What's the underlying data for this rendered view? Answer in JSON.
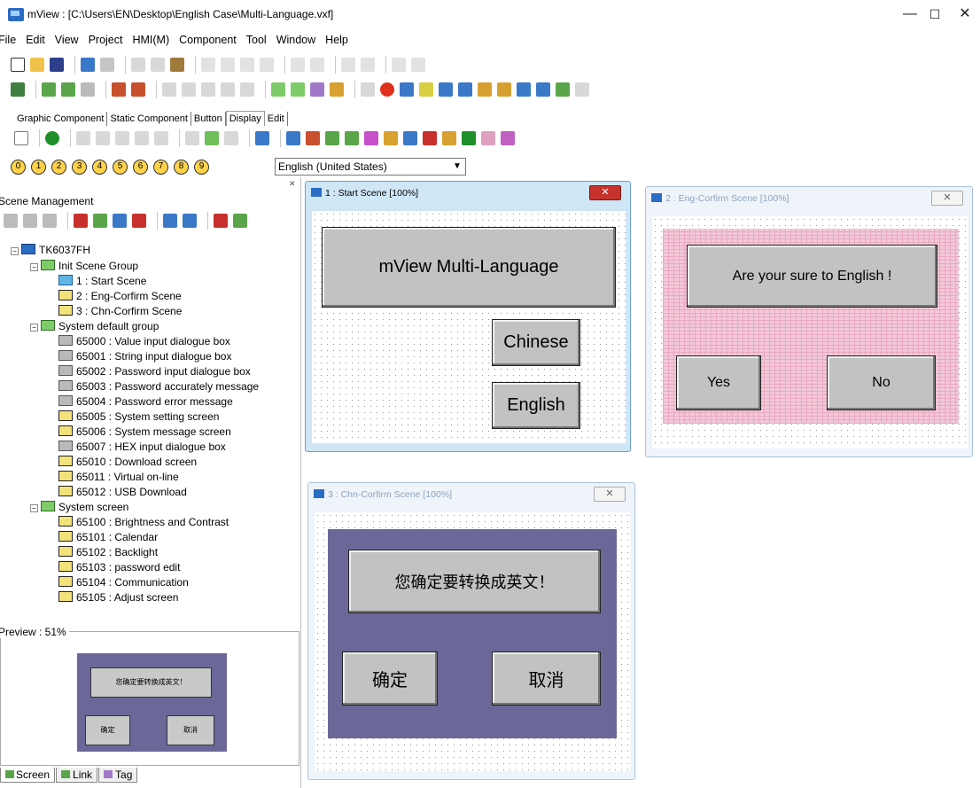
{
  "window": {
    "title": "mView : [C:\\Users\\EN\\Desktop\\English Case\\Multi-Language.vxf]",
    "minimize": "—",
    "maximize": "☐",
    "close": "✕"
  },
  "menu": [
    "File",
    "Edit",
    "View",
    "Project",
    "HMI(M)",
    "Component",
    "Tool",
    "Window",
    "Help"
  ],
  "component_tabs": [
    "Graphic Component",
    "Static Component",
    "Button",
    "Display",
    "Edit"
  ],
  "active_tab": "Display",
  "language_buttons": [
    "0",
    "1",
    "2",
    "3",
    "4",
    "5",
    "6",
    "7",
    "8",
    "9"
  ],
  "language_select": "English (United States)",
  "scene_management": {
    "title": "Scene Management",
    "tree": {
      "project": "TK6037FH",
      "groups": [
        {
          "label": "Init Scene Group",
          "items": [
            "1 : Start Scene",
            "2 : Eng-Corfirm Scene",
            "3 : Chn-Corfirm Scene"
          ]
        },
        {
          "label": "System default group",
          "items": [
            "65000 : Value input dialogue box",
            "65001 : String input dialogue box",
            "65002 : Password input dialogue box",
            "65003 : Password accurately message",
            "65004 : Password error message",
            "65005 : System setting screen",
            "65006 : System message screen",
            "65007 : HEX input dialogue box",
            "65010 : Download screen",
            "65011 : Virtual on-line",
            "65012 : USB Download"
          ]
        },
        {
          "label": "System screen",
          "items": [
            "65100 : Brightness and Contrast",
            "65101 : Calendar",
            "65102 : Backlight",
            "65103 : password edit",
            "65104 : Communication",
            "65105 : Adjust screen"
          ]
        }
      ]
    }
  },
  "preview": {
    "title": "Preview : 51%",
    "text": "您确定要转换成英文！",
    "btn1": "确定",
    "btn2": "取消"
  },
  "bottom_tabs": [
    "Screen",
    "Link",
    "Tag"
  ],
  "scenes": {
    "start": {
      "title": "1 : Start Scene [100%]",
      "header": "mView Multi-Language",
      "btn_chinese": "Chinese",
      "btn_english": "English"
    },
    "eng": {
      "title": "2 : Eng-Corfirm Scene [100%]",
      "message": "Are your sure to English !",
      "btn_yes": "Yes",
      "btn_no": "No"
    },
    "chn": {
      "title": "3 : Chn-Corfirm Scene [100%]",
      "message": "您确定要转换成英文！",
      "btn_ok": "确定",
      "btn_cancel": "取消"
    }
  },
  "colors": {
    "chn_bg": "#6b6899",
    "eng_bg": "#f2c9d9",
    "active_close": "#c8322c"
  }
}
